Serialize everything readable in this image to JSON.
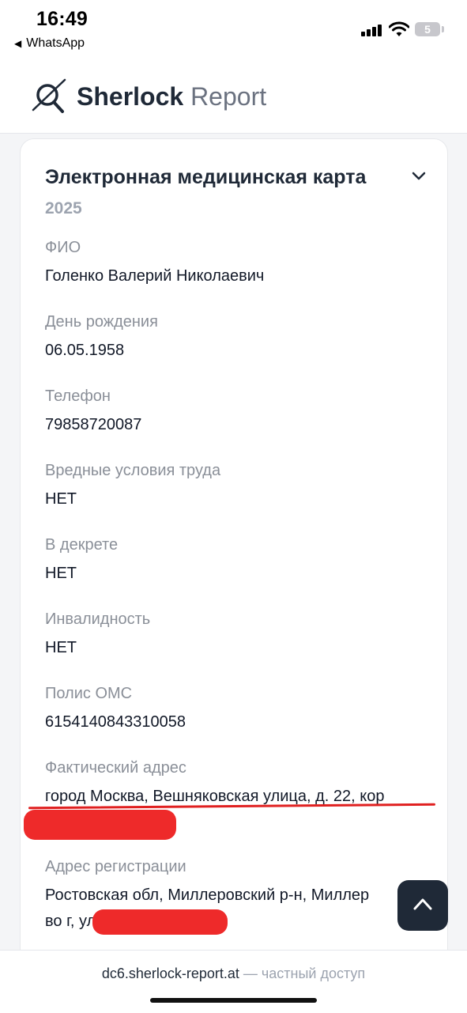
{
  "status_bar": {
    "time": "16:49",
    "back_app": "WhatsApp",
    "battery": "5"
  },
  "header": {
    "brand_bold": "Sherlock",
    "brand_light": "Report"
  },
  "card": {
    "title": "Электронная медицинская карта",
    "year": "2025",
    "fields": [
      {
        "label": "ФИО",
        "value": "Голенко Валерий Николаевич"
      },
      {
        "label": "День рождения",
        "value": "06.05.1958"
      },
      {
        "label": "Телефон",
        "value": "79858720087"
      },
      {
        "label": "Вредные условия труда",
        "value": "НЕТ"
      },
      {
        "label": "В декрете",
        "value": "НЕТ"
      },
      {
        "label": "Инвалидность",
        "value": "НЕТ"
      },
      {
        "label": "Полис ОМС",
        "value": "6154140843310058"
      },
      {
        "label": "Фактический адрес",
        "value": "город Москва, Вешняковская улица, д. 22, кор"
      },
      {
        "label": "Адрес регистрации",
        "value": "Ростовская обл, Миллеровский р-н, Миллер",
        "value_line2": "во г, ул"
      }
    ]
  },
  "footer": {
    "host": "dc6.sherlock-report.at",
    "note": " — частный доступ"
  },
  "colors": {
    "accent_dark": "#1f2937",
    "muted": "#8a8f98",
    "redaction": "#ee2a2a"
  },
  "icons": [
    "back-triangle-icon",
    "signal-icon",
    "wifi-icon",
    "battery-icon",
    "sherlock-logo-icon",
    "chevron-down-icon",
    "arrow-up-icon"
  ]
}
